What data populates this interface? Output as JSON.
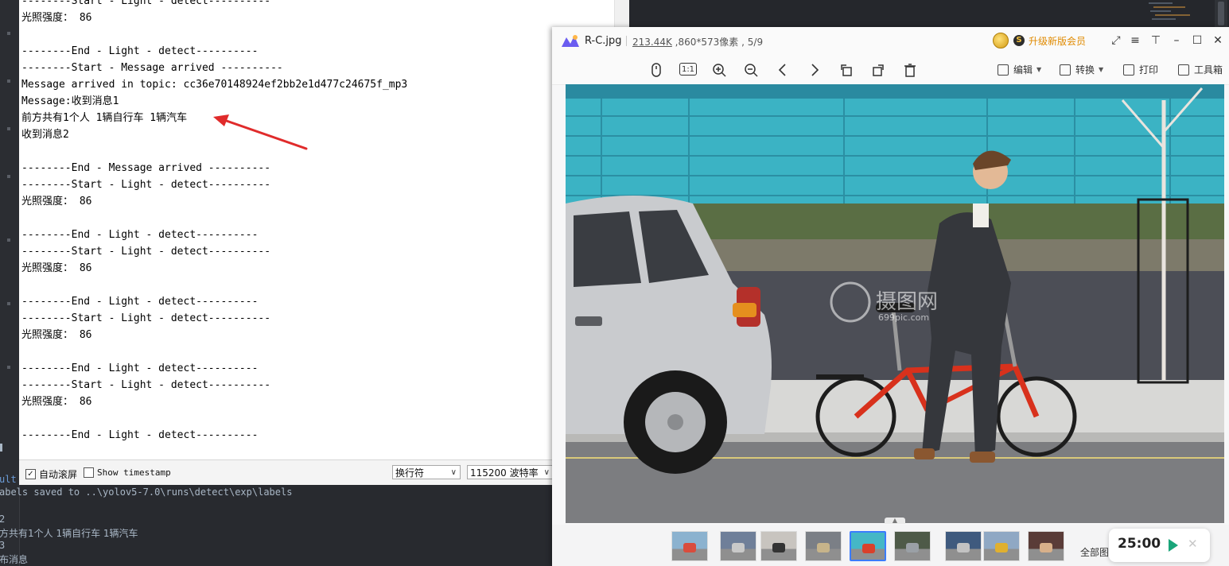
{
  "ide_console": {
    "line1": "ult",
    "line2": "abels saved to ..\\yolov5-7.0\\runs\\detect\\exp\\labels",
    "line3": "2",
    "line4": "方共有1个人 1辆自行车 1辆汽车",
    "line5": "3",
    "line6": "布消息"
  },
  "serial_monitor": {
    "lines": [
      "--------Start - Light - detect----------",
      "光照强度： 86",
      "",
      "--------End - Light - detect----------",
      "--------Start - Message arrived ----------",
      "Message arrived in topic: cc36e70148924ef2bb2e1d477c24675f_mp3",
      "Message:收到消息1",
      "前方共有1个人 1辆自行车 1辆汽车",
      "收到消息2",
      "",
      "--------End - Message arrived ----------",
      "--------Start - Light - detect----------",
      "光照强度： 86",
      "",
      "--------End - Light - detect----------",
      "--------Start - Light - detect----------",
      "光照强度： 86",
      "",
      "--------End - Light - detect----------",
      "--------Start - Light - detect----------",
      "光照强度： 86",
      "",
      "--------End - Light - detect----------",
      "--------Start - Light - detect----------",
      "光照强度： 86",
      "",
      "--------End - Light - detect----------"
    ],
    "autoscroll_label": "自动滚屏",
    "autoscroll_checked": true,
    "timestamp_label": "Show timestamp",
    "timestamp_checked": false,
    "line_ending": "换行符",
    "baud_rate": "115200 波特率"
  },
  "viewer": {
    "filename": "R-C.jpg",
    "filesize": "213.44K",
    "dimensions": "860*573像素",
    "index": "5/9",
    "upgrade_label": "升级新版会员",
    "edit_label": "编辑",
    "convert_label": "转换",
    "print_label": "打印",
    "toolbox_label": "工具箱",
    "fit_label": "1:1",
    "all_images_label": "全部图",
    "timer": "25:00",
    "watermark_text": "摄图网",
    "watermark_sub": "699pic.com",
    "thumbnails": [
      {
        "color": "#8bb2cf",
        "accent": "#d94c3d"
      },
      {
        "color": "#6f7f99",
        "accent": "#c9c9c9"
      },
      {
        "color": "#c8c4bf",
        "accent": "#333333"
      },
      {
        "color": "#7b7f86",
        "accent": "#c7b48a"
      },
      {
        "color": "#45b7c6",
        "accent": "#d9402b"
      },
      {
        "color": "#4e5a48",
        "accent": "#9aa0a6"
      },
      {
        "color": "#3f5a7e",
        "accent": "#c2c2c2"
      },
      {
        "color": "#8fa8c4",
        "accent": "#e0b030"
      },
      {
        "color": "#5a3c38",
        "accent": "#d8b08a"
      }
    ],
    "active_thumbnail": 4
  },
  "colors": {
    "annotation_arrow": "#e02b2b",
    "accent_blue": "#3b7cff",
    "upgrade_orange": "#e08a00"
  }
}
